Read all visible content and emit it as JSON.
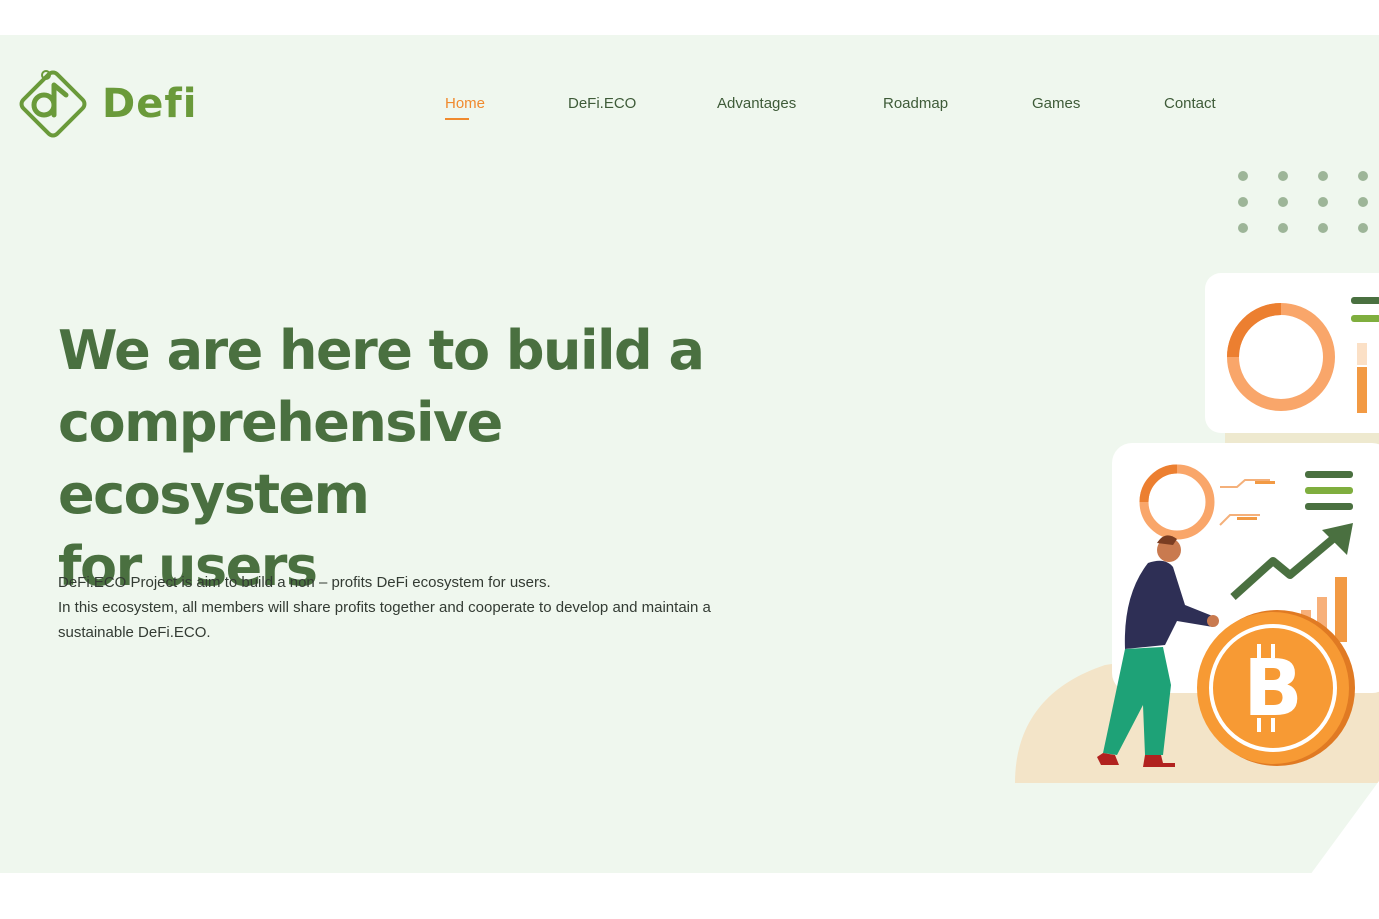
{
  "brand": {
    "name": "Defi",
    "logo_icon": "defi-diamond-logo-icon"
  },
  "nav": {
    "items": [
      {
        "label": "Home",
        "active": true
      },
      {
        "label": "DeFi.ECO",
        "active": false
      },
      {
        "label": "Advantages",
        "active": false
      },
      {
        "label": "Roadmap",
        "active": false
      },
      {
        "label": "Games",
        "active": false
      },
      {
        "label": "Contact",
        "active": false
      }
    ]
  },
  "hero": {
    "headline_line1": "We are here to build a",
    "headline_line2": "comprehensive ecosystem",
    "headline_line3": "for users",
    "desc_line1": "DeFi.ECO Project is aim to build a non – profits DeFi ecosystem for users.",
    "desc_line2": "In this ecosystem, all members will share profits together and cooperate to develop and maintain a",
    "desc_line3": "sustainable DeFi.ECO."
  },
  "illustration": {
    "coin_symbol": "B",
    "icon": "bitcoin-coin-icon"
  },
  "colors": {
    "accent": "#f08a2e",
    "brand_green": "#6a9a3a",
    "headline_green": "#4a7040",
    "hero_bg": "#eff7ee"
  }
}
